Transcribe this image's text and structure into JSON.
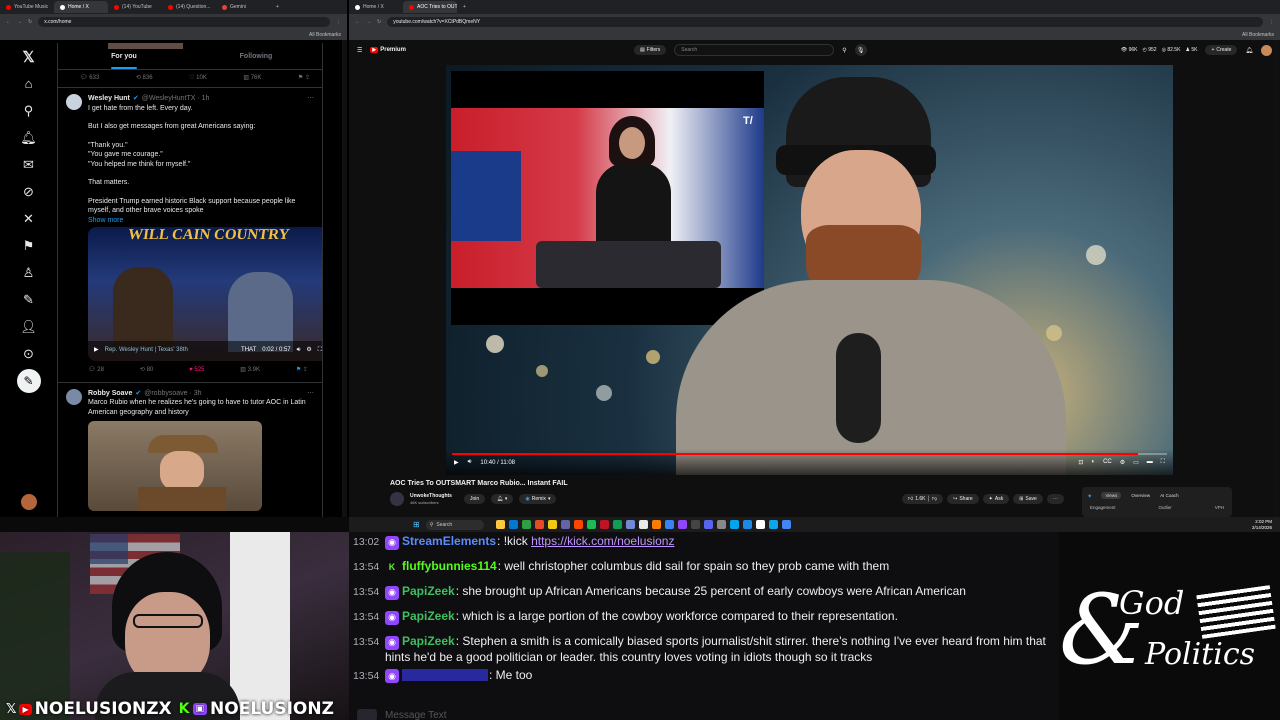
{
  "left_browser": {
    "tabs": [
      {
        "label": "YouTube Music",
        "color": "#ff0000"
      },
      {
        "label": "Home / X",
        "color": "#ffffff",
        "active": true
      },
      {
        "label": "(14) YouTube",
        "color": "#ff0000"
      },
      {
        "label": "(14) Question...",
        "color": "#ff0000"
      },
      {
        "label": "Gemini",
        "color": "#ea4335"
      }
    ],
    "address": "x.com/home",
    "bookmarks": "All Bookmarks"
  },
  "x": {
    "tabs": {
      "for_you": "For you",
      "following": "Following"
    },
    "top_stats": {
      "replies": "633",
      "reposts": "836",
      "likes": "10K",
      "views": "76K"
    },
    "tweets": [
      {
        "name": "Wesley Hunt",
        "handle": "@WesleyHuntTX · 1h",
        "lines": [
          "I get hate from the left. Every day.",
          "",
          "But I also get messages from great Americans saying:",
          "",
          "\"Thank you.\"",
          "\"You gave me courage.\"",
          "\"You helped me think for myself.\"",
          "",
          "That matters.",
          "",
          "President Trump earned historic Black support because people like myself, and other brave voices spoke"
        ],
        "show_more": "Show more",
        "video_time": "0:02 / 0:57",
        "video_caption": "Rep. Wesley Hunt | Texas' 38th",
        "video_overlay": "THAT",
        "media_brand": "WILL CAIN COUNTRY",
        "stats": {
          "replies": "28",
          "reposts": "80",
          "likes": "525",
          "views": "3.9K"
        }
      },
      {
        "name": "Robby Soave",
        "handle": "@robbysoave · 3h",
        "lines": [
          "Marco Rubio when he realizes he's going to have to tutor AOC in Latin",
          "American geography and history"
        ]
      }
    ]
  },
  "right_browser": {
    "tabs": [
      {
        "label": "Home / X",
        "color": "#ffffff"
      },
      {
        "label": "AOC Tries to OUTSMART Marc...",
        "color": "#ff0000",
        "active": true
      }
    ],
    "address": "youtube.com/watch?v=XCtPdBQmeNY",
    "bookmarks": "All Bookmarks"
  },
  "youtube": {
    "logo": "Premium",
    "filters": "Filters",
    "search_placeholder": "Search",
    "stats": [
      "96K",
      "952",
      "82.5K",
      "5K"
    ],
    "create": "Create",
    "time": "10:40 / 11:08",
    "progress": 0.96,
    "title": "AOC Tries To OUTSMART Marco Rubio... Instant FAIL",
    "channel": "UnwokeThoughts",
    "subscribers": "46K subscribers",
    "join": "Join",
    "remix": "Remix",
    "likes": "1.6K",
    "share": "Share",
    "ask": "Ask",
    "save": "Save",
    "panel_tabs": [
      "Views",
      "Overview",
      "AI Coach"
    ],
    "panel_cols": [
      "Engagement",
      "Outlier",
      "VPH"
    ]
  },
  "taskbar": {
    "search": "Search",
    "time": "2:02 PM",
    "date": "2/14/2026"
  },
  "chat": {
    "messages": [
      {
        "time": "13:02",
        "user": "StreamElements",
        "color": "#5b8cff",
        "text": ": !kick ",
        "link": "https://kick.com/noelusionz",
        "badge": "twitch"
      },
      {
        "time": "13:54",
        "user": "fluffybunnies114",
        "color": "#53fc18",
        "text": ": well christopher columbus did sail for spain so they prob came with them",
        "badge": "kick"
      },
      {
        "time": "13:54",
        "user": "PapiZeek",
        "color": "#3fbf5f",
        "text": ": she brought up African Americans because 25 percent of early cowboys were African American",
        "badge": "twitch"
      },
      {
        "time": "13:54",
        "user": "PapiZeek",
        "color": "#3fbf5f",
        "text": ": which is a large portion of the cowboy workforce compared to their representation.",
        "badge": "twitch"
      },
      {
        "time": "13:54",
        "user": "PapiZeek",
        "color": "#3fbf5f",
        "text": ": Stephen a smith is a comically biased sports journalist/shit stirrer. there's nothing I've ever heard from him that hints he'd be a good politician or leader. this country loves voting in idiots though so it tracks",
        "badge": "twitch"
      },
      {
        "time": "13:54",
        "user": "",
        "color": "#3a3aff",
        "text": ": Me too",
        "badge": "twitch"
      }
    ],
    "input_placeholder": "Message Text"
  },
  "overlay": {
    "handle_youtube": "NOELUSIONZX",
    "handle_kick_twitch": "NOELUSIONZ",
    "logo_top": "God",
    "logo_bottom": "Politics"
  }
}
